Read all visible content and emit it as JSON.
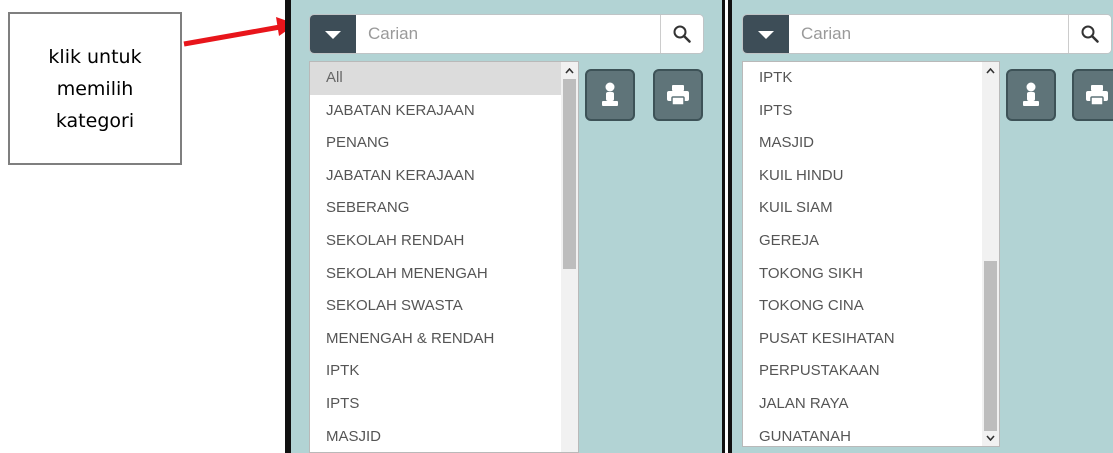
{
  "callout": {
    "text": "klik untuk\nmemilih\nkategori"
  },
  "colors": {
    "arrow": "#e8151b",
    "dropdown_button": "#3d4d57",
    "map_bg": "#b2d3d4",
    "tool_button": "#5f7479"
  },
  "left_panel": {
    "search": {
      "placeholder": "Carian",
      "dropdown_icon": "caret-down-icon",
      "search_icon": "magnifier-icon"
    },
    "tools": [
      {
        "icon": "person-icon"
      },
      {
        "icon": "printer-icon"
      }
    ],
    "dropdown": {
      "selected": "All",
      "items": [
        "All",
        "JABATAN KERAJAAN",
        "PENANG",
        "JABATAN KERAJAAN",
        "SEBERANG",
        "SEKOLAH RENDAH",
        "SEKOLAH MENENGAH",
        "SEKOLAH SWASTA",
        "MENENGAH & RENDAH",
        "IPTK",
        "IPTS",
        "MASJID"
      ],
      "scroll_position": 0.0
    }
  },
  "right_panel": {
    "search": {
      "placeholder": "Carian",
      "dropdown_icon": "caret-down-icon",
      "search_icon": "magnifier-icon"
    },
    "tools": [
      {
        "icon": "person-icon"
      },
      {
        "icon": "printer-icon"
      }
    ],
    "dropdown": {
      "items": [
        "IPTK",
        "IPTS",
        "MASJID",
        "KUIL HINDU",
        "KUIL SIAM",
        "GEREJA",
        "TOKONG SIKH",
        "TOKONG CINA",
        "PUSAT KESIHATAN",
        "PERPUSTAKAAN",
        "JALAN RAYA",
        "GUNATANAH"
      ],
      "scroll_position": 1.0
    }
  }
}
